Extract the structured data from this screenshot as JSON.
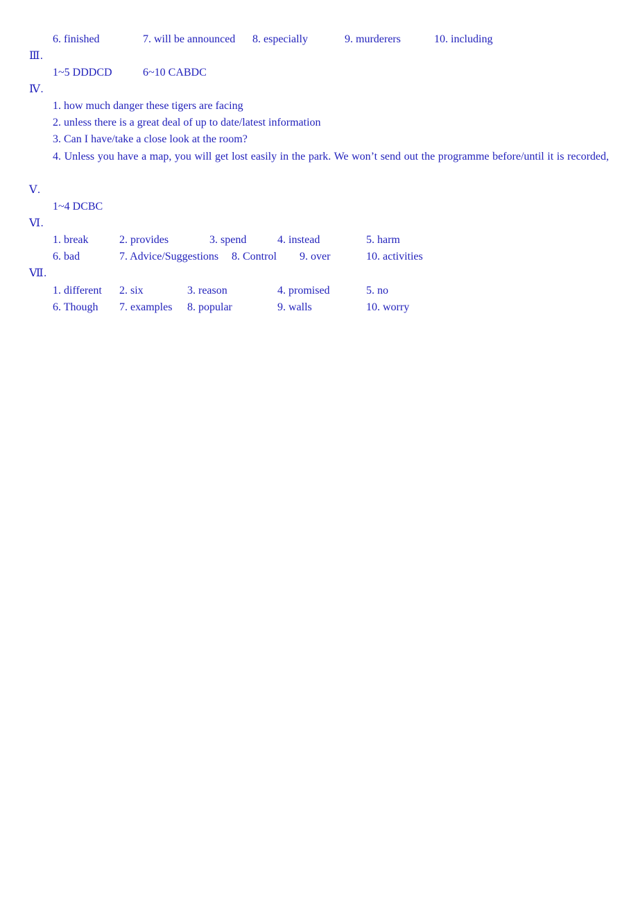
{
  "document": {
    "text_color": "#2222bb",
    "background_color": "#ffffff",
    "sections": {
      "three": {
        "marker": "Ⅲ.",
        "answers": {
          "range_1_5": "1~5 DDDCD",
          "range_6_10": "6~10 CABDC"
        }
      },
      "four": {
        "marker": "Ⅳ.",
        "items": [
          "1. how much danger these tigers are facing",
          "2. unless there is a great deal of up to date/latest information",
          "3. Can I have/take a close look at the room?",
          "4. Unless you have a map, you will get lost easily in the park. We won’t send out the programme before/until it is recorded,"
        ]
      },
      "five": {
        "marker": "Ⅴ.",
        "answers": {
          "range_1_4": "1~4 DCBC"
        }
      },
      "six": {
        "marker": "Ⅵ.",
        "row1": [
          "1. break",
          "2. provides",
          "3. spend",
          "4. instead",
          "5. harm"
        ],
        "row2": [
          "6. bad",
          "7. Advice/Suggestions",
          "8. Control",
          "9. over",
          "10. activities"
        ]
      },
      "seven": {
        "marker": "Ⅶ.",
        "row1": [
          "1. different",
          "2. six",
          "3. reason",
          "4. promised",
          "5. no"
        ],
        "row2": [
          "6. Though",
          "7. examples",
          "8. popular",
          "9. walls",
          "10. worry"
        ]
      }
    },
    "top_row": {
      "items": [
        "6. finished",
        "7. will be announced",
        "8. especially",
        "9. murderers",
        "10. including"
      ]
    }
  }
}
